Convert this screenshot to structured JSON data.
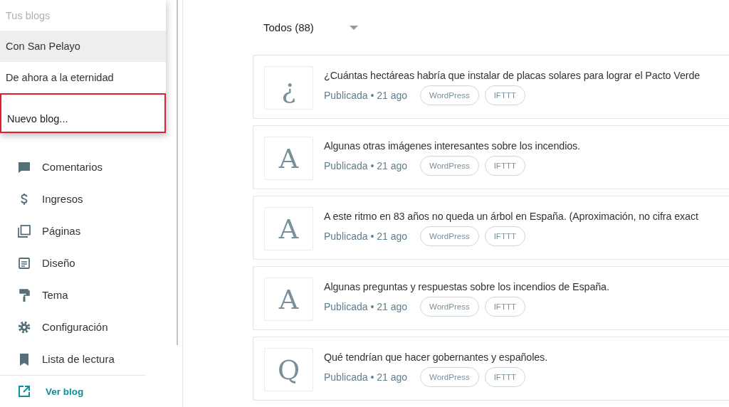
{
  "blog_menu": {
    "header": "Tus blogs",
    "blogs": [
      {
        "name": "Con San Pelayo",
        "selected": true
      },
      {
        "name": "De ahora a la eternidad",
        "selected": false
      }
    ],
    "new_blog": {
      "label": "Nuevo blog...",
      "highlighted": true
    }
  },
  "sidebar": {
    "items": [
      {
        "label": "Comentarios"
      },
      {
        "label": "Ingresos"
      },
      {
        "label": "Páginas"
      },
      {
        "label": "Diseño"
      },
      {
        "label": "Tema"
      },
      {
        "label": "Configuración"
      },
      {
        "label": "Lista de lectura"
      }
    ],
    "view_blog": "Ver blog"
  },
  "filter": {
    "label": "Todos (88)"
  },
  "posts": [
    {
      "initial": "¿",
      "title": "¿Cuántas hectáreas habría que instalar de placas solares para lograr el Pacto Verde",
      "status": "Publicada • 21 ago",
      "tags": [
        "WordPress",
        "IFTTT"
      ]
    },
    {
      "initial": "A",
      "title": "Algunas otras imágenes interesantes sobre los incendios.",
      "status": "Publicada • 21 ago",
      "tags": [
        "WordPress",
        "IFTTT"
      ]
    },
    {
      "initial": "A",
      "title": "A este ritmo en 83 años no queda un árbol en España. (Aproximación, no cifra exact",
      "status": "Publicada • 21 ago",
      "tags": [
        "WordPress",
        "IFTTT"
      ]
    },
    {
      "initial": "A",
      "title": "Algunas preguntas y respuestas sobre los incendios de España.",
      "status": "Publicada • 21 ago",
      "tags": [
        "WordPress",
        "IFTTT"
      ]
    },
    {
      "initial": "Q",
      "title": "Qué tendrían que hacer gobernantes y españoles.",
      "status": "Publicada • 21 ago",
      "tags": [
        "WordPress",
        "IFTTT"
      ]
    }
  ]
}
